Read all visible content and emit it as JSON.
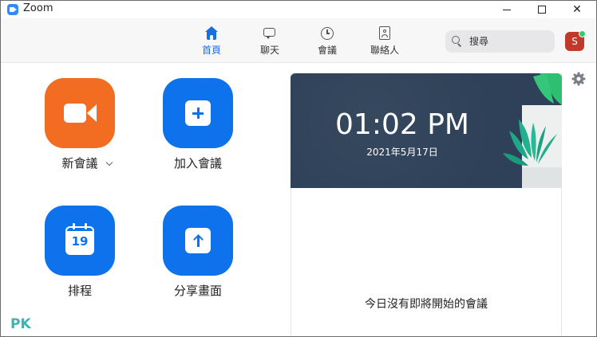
{
  "window": {
    "title": "Zoom"
  },
  "nav": {
    "tabs": [
      {
        "label": "首頁",
        "icon": "home-icon",
        "active": true
      },
      {
        "label": "聊天",
        "icon": "chat-icon",
        "active": false
      },
      {
        "label": "會議",
        "icon": "clock-icon",
        "active": false
      },
      {
        "label": "聯絡人",
        "icon": "contacts-icon",
        "active": false
      }
    ],
    "search": {
      "placeholder": "搜尋"
    },
    "avatar": {
      "initial": "S",
      "status": "online"
    }
  },
  "actions": {
    "new_meeting": {
      "label": "新會議",
      "icon": "video-camera-icon"
    },
    "join": {
      "label": "加入會議",
      "icon": "plus-icon"
    },
    "schedule": {
      "label": "排程",
      "icon": "calendar-icon",
      "day": "19"
    },
    "share_screen": {
      "label": "分享畫面",
      "icon": "upload-arrow-icon"
    }
  },
  "clock": {
    "time": "01:02 PM",
    "date": "2021年5月17日"
  },
  "meetings": {
    "empty_text": "今日沒有即將開始的會議"
  },
  "watermark": {
    "text": "PK"
  },
  "colors": {
    "accent": "#0e72ed",
    "orange": "#f26d21",
    "banner": "#2e4158",
    "avatar": "#c0392b",
    "online": "#2ecc71"
  }
}
